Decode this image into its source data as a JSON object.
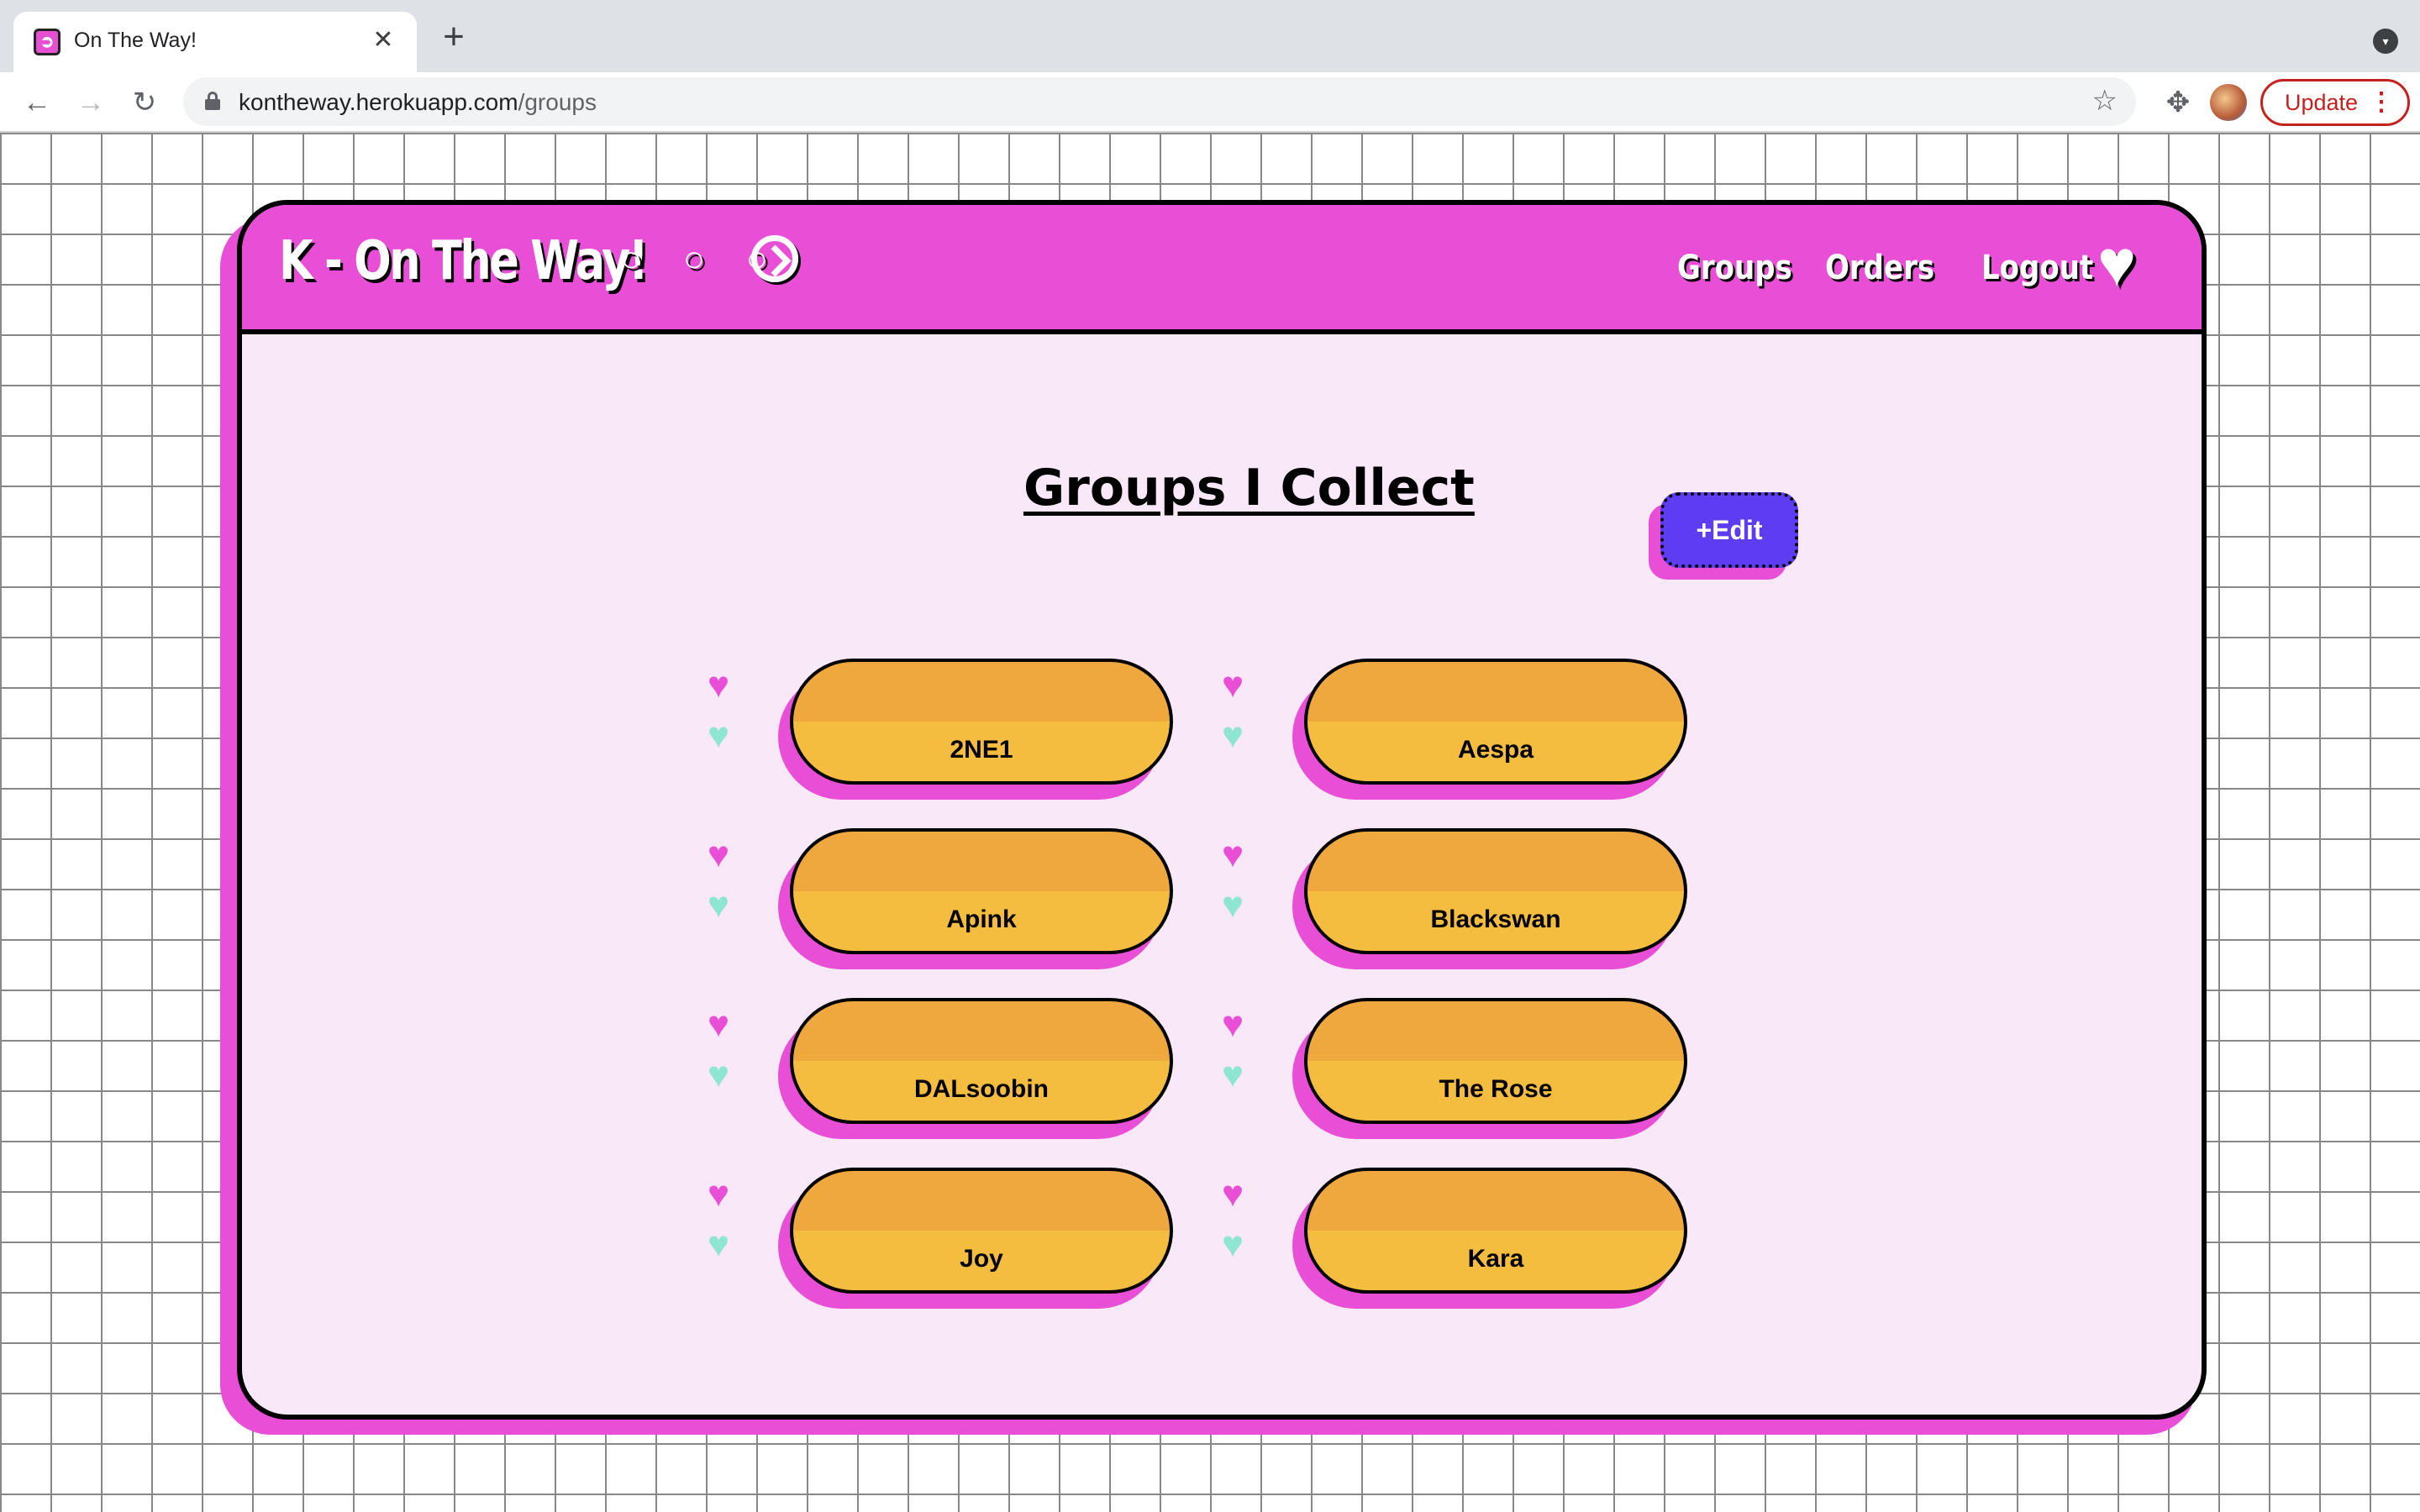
{
  "browser": {
    "tab_title": "On The Way!",
    "tab_close": "✕",
    "new_tab": "+",
    "url_host": "kontheway.herokuapp.com",
    "url_path": "/groups",
    "update_label": "Update"
  },
  "site": {
    "brand": "K - On The Way!",
    "brand_dots": "○ ○ ○",
    "nav": {
      "groups": "Groups",
      "orders": "Orders",
      "logout": "Logout"
    }
  },
  "main": {
    "title": "Groups I Collect",
    "edit_label": "+Edit",
    "groups": [
      "2NE1",
      "Aespa",
      "Apink",
      "Blackswan",
      "DALsoobin",
      "The Rose",
      "Joy",
      "Kara"
    ]
  },
  "colors": {
    "accent_pink": "#e94fd6",
    "edit_purple": "#5e3cf2",
    "pill_orange": "#f5bd40",
    "heart_mint": "#8fe6d0",
    "card_bg": "#f9e9f8"
  }
}
